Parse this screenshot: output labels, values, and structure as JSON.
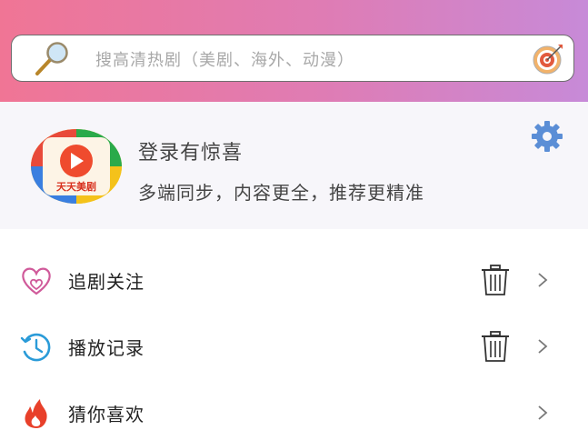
{
  "search": {
    "placeholder": "搜高清热剧（美剧、海外、动漫）"
  },
  "profile": {
    "logo_text": "天天美剧",
    "login_title": "登录有惊喜",
    "login_subtitle": "多端同步，内容更全，推荐更精准"
  },
  "menu": [
    {
      "label": "追剧关注",
      "icon": "heart-icon",
      "has_delete": true
    },
    {
      "label": "播放记录",
      "icon": "history-icon",
      "has_delete": true
    },
    {
      "label": "猜你喜欢",
      "icon": "fire-icon",
      "has_delete": false
    }
  ],
  "colors": {
    "header_start": "#f07595",
    "header_end": "#c78ad8",
    "profile_bg": "#f7f6fa",
    "gear": "#5b8ed6",
    "history_icon": "#2a9bd8",
    "fire_icon": "#e8402a",
    "heart_icon": "#d05a9a"
  }
}
